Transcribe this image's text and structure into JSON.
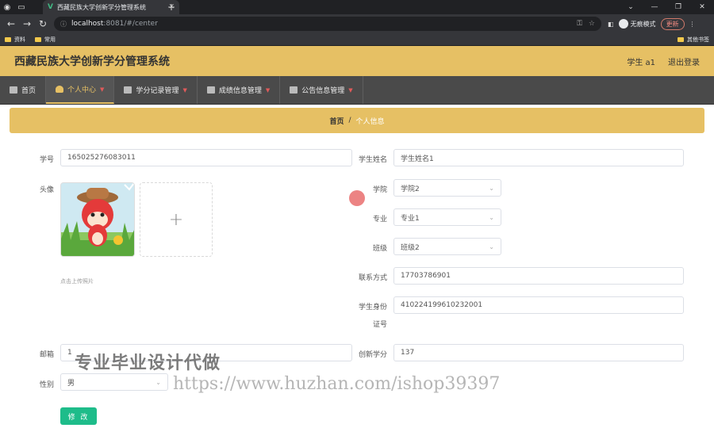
{
  "browser": {
    "tab_title": "西藏民族大学创新学分管理系统",
    "url_host": "localhost",
    "url_path": ":8081/#/center",
    "incognito_label": "无痕模式",
    "update_label": "更新",
    "bookmarks": [
      "资料",
      "常用"
    ],
    "other_bookmarks": "其他书签"
  },
  "header": {
    "title": "西藏民族大学创新学分管理系统",
    "user": "学生 a1",
    "logout": "退出登录"
  },
  "menu": {
    "items": [
      {
        "label": "首页",
        "icon": "home-icon"
      },
      {
        "label": "个人中心",
        "icon": "user-icon"
      },
      {
        "label": "学分记录管理",
        "icon": "box-icon"
      },
      {
        "label": "成绩信息管理",
        "icon": "list-icon"
      },
      {
        "label": "公告信息管理",
        "icon": "chat-icon"
      }
    ]
  },
  "breadcrumb": {
    "home": "首页",
    "sep": "/",
    "current": "个人信息"
  },
  "form": {
    "student_no_label": "学号",
    "student_no": "165025276083011",
    "name_label": "学生姓名",
    "name": "学生姓名1",
    "avatar_label": "头像",
    "upload_hint": "点击上传照片",
    "college_label": "学院",
    "college": "学院2",
    "major_label": "专业",
    "major": "专业1",
    "class_label": "班级",
    "class": "班级2",
    "phone_label": "联系方式",
    "phone": "17703786901",
    "id_label_1": "学生身份",
    "id_label_2": "证号",
    "id_number": "410224199610232001",
    "email_label": "邮箱",
    "email": "1",
    "credit_label": "创新学分",
    "credit": "137",
    "gender_label": "性别",
    "gender": "男",
    "submit": "修 改"
  },
  "watermark": {
    "line1": "专业毕业设计代做",
    "line2": "https://www.huzhan.com/ishop39397"
  }
}
